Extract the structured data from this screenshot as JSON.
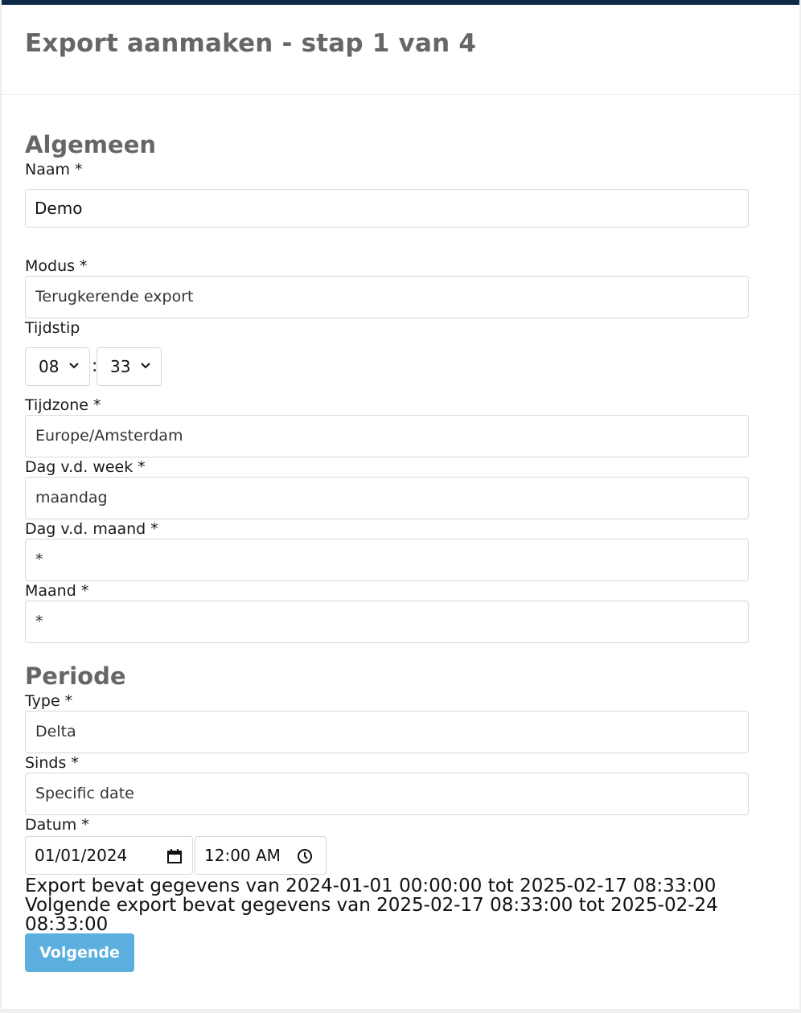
{
  "header": {
    "title": "Export aanmaken - stap 1 van 4"
  },
  "general": {
    "title": "Algemeen",
    "name_label": "Naam *",
    "name_value": "Demo",
    "mode_label": "Modus *",
    "mode_value": "Terugkerende export",
    "time_label": "Tijdstip",
    "hour_value": "08",
    "minute_value": "33",
    "time_separator": ":",
    "timezone_label": "Tijdzone *",
    "timezone_value": "Europe/Amsterdam",
    "weekday_label": "Dag v.d. week *",
    "weekday_value": "maandag",
    "monthday_label": "Dag v.d. maand *",
    "monthday_value": "*",
    "month_label": "Maand *",
    "month_value": "*"
  },
  "period": {
    "title": "Periode",
    "type_label": "Type *",
    "type_value": "Delta",
    "since_label": "Sinds *",
    "since_value": "Specific date",
    "date_label": "Datum *",
    "date_value": "01/01/2024",
    "time_value": "12:00 AM"
  },
  "info": {
    "line1": "Export bevat gegevens van 2024-01-01 00:00:00 tot 2025-02-17 08:33:00",
    "line2": "Volgende export bevat gegevens van 2025-02-17 08:33:00 tot 2025-02-24 08:33:00"
  },
  "actions": {
    "next_label": "Volgende"
  },
  "colors": {
    "header_bar": "#0f2a48",
    "button": "#5aafdf",
    "heading": "#666666"
  },
  "icons": {
    "select": "chevron-down-icon",
    "date": "calendar-icon",
    "time": "clock-icon"
  }
}
